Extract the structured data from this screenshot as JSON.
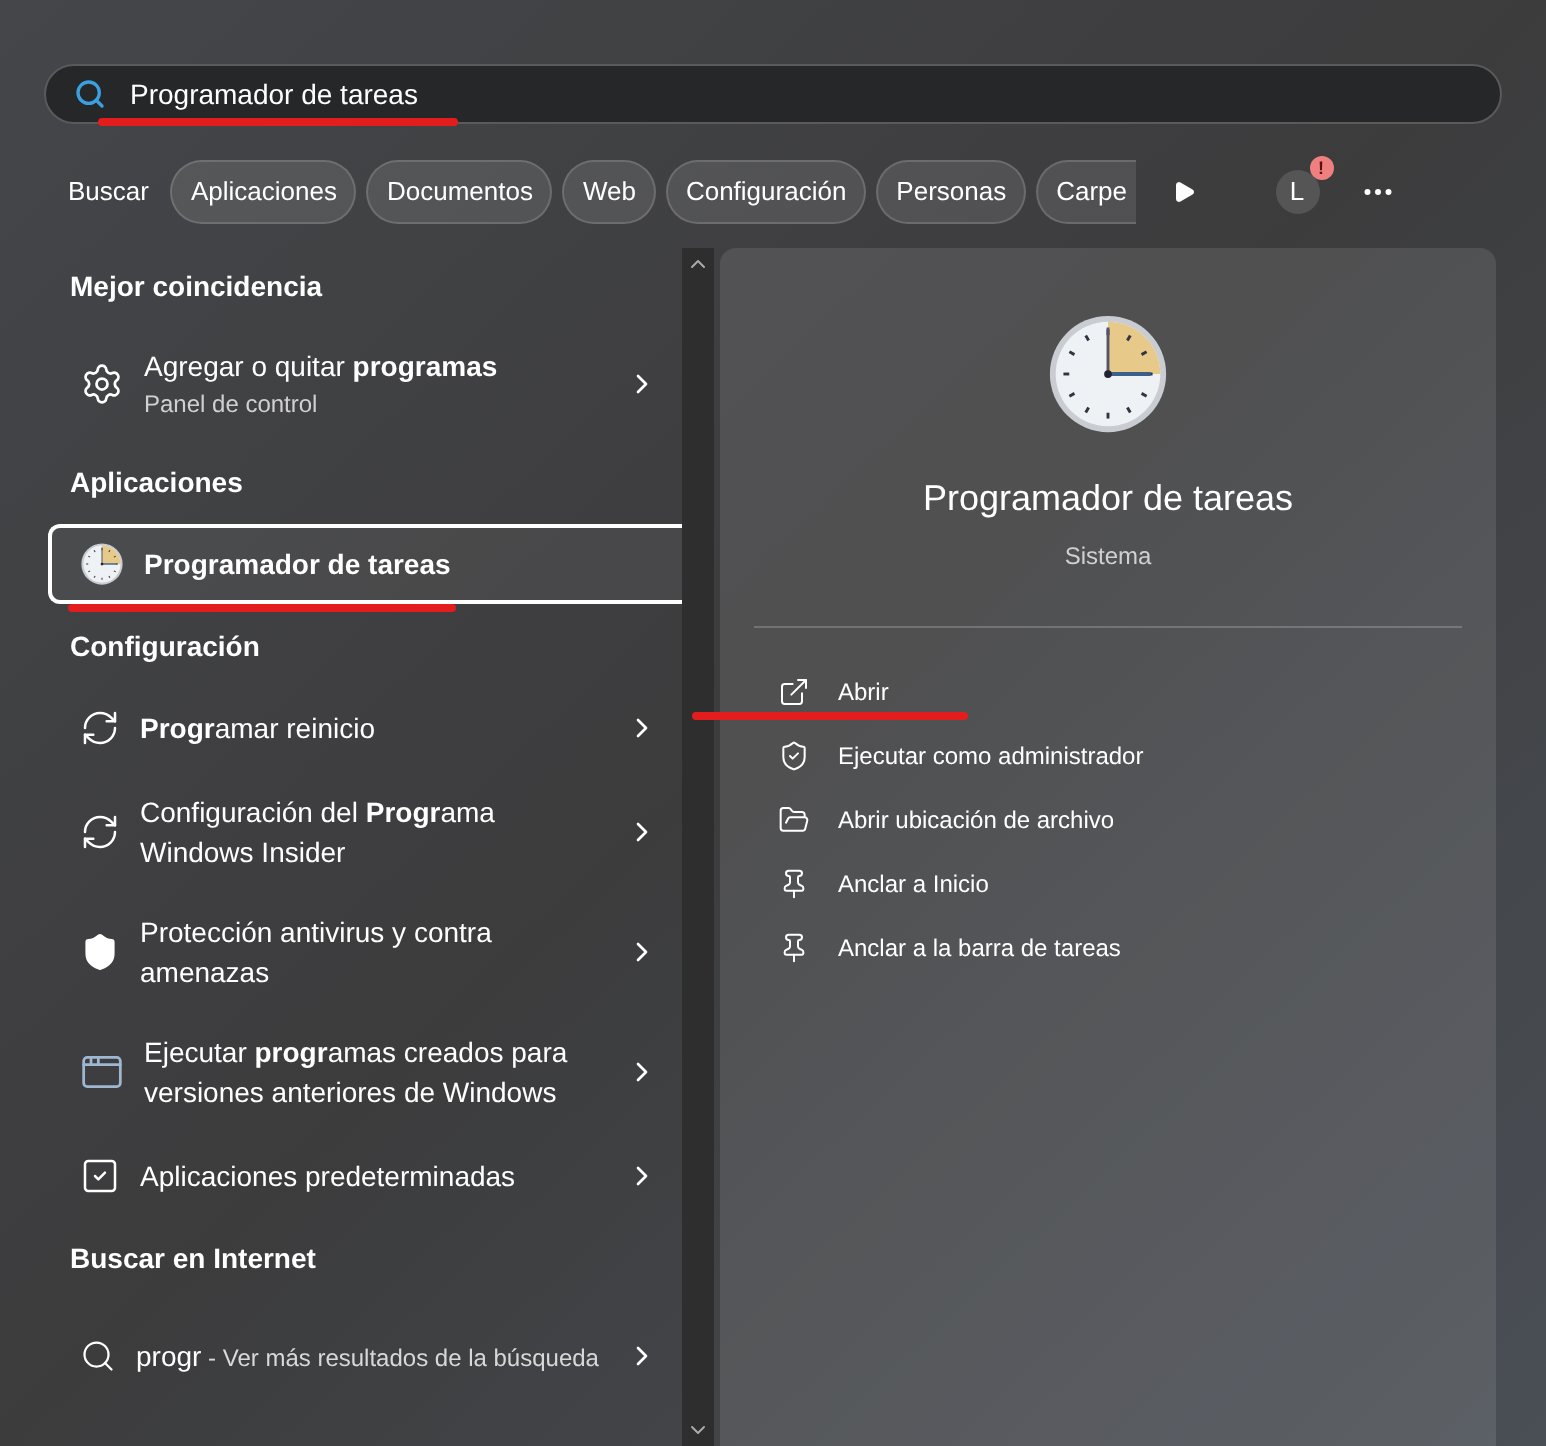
{
  "search": {
    "value": "Programador de tareas",
    "underlined": true
  },
  "filters": [
    {
      "label": "Buscar",
      "selected": true
    },
    {
      "label": "Aplicaciones",
      "selected": false
    },
    {
      "label": "Documentos",
      "selected": false
    },
    {
      "label": "Web",
      "selected": false
    },
    {
      "label": "Configuración",
      "selected": false
    },
    {
      "label": "Personas",
      "selected": false
    },
    {
      "label": "Carpe",
      "selected": false
    }
  ],
  "account": {
    "initial": "L",
    "badge": "!"
  },
  "sections": [
    {
      "title": "Mejor coincidencia",
      "items": [
        {
          "kind": "gear",
          "title": "Agregar o quitar **programas**",
          "subtitle": "Panel de control",
          "selected": false,
          "underlined": false,
          "chevron": true
        }
      ]
    },
    {
      "title": "Aplicaciones",
      "items": [
        {
          "kind": "clock",
          "title": "**Progr**amador de tareas",
          "selected": true,
          "underlined": true,
          "chevron": false
        }
      ]
    },
    {
      "title": "Configuración",
      "items": [
        {
          "kind": "refresh",
          "title": "**Progr**amar reinicio",
          "selected": false,
          "underlined": false,
          "chevron": true
        },
        {
          "kind": "refresh",
          "title": "Configuración del **Progr**ama Windows Insider",
          "selected": false,
          "underlined": false,
          "chevron": true
        },
        {
          "kind": "shield",
          "title": "Protección antivirus y contra amenazas",
          "selected": false,
          "underlined": false,
          "chevron": true
        },
        {
          "kind": "window",
          "title": "Ejecutar **progr**amas creados para versiones anteriores de Windows",
          "selected": false,
          "underlined": false,
          "chevron": true
        },
        {
          "kind": "defaults",
          "title": "Aplicaciones predeterminadas",
          "selected": false,
          "underlined": false,
          "chevron": true
        }
      ]
    },
    {
      "title": "Buscar en Internet",
      "items": [
        {
          "kind": "search",
          "title": "progr",
          "description": " - Ver más resultados de la búsqueda",
          "selected": false,
          "underlined": false,
          "chevron": true
        }
      ]
    }
  ],
  "detail": {
    "title": "Programador de tareas",
    "subtitle": "Sistema",
    "actions": [
      {
        "kind": "open",
        "label": "Abrir",
        "underlined": true
      },
      {
        "kind": "admin",
        "label": "Ejecutar como administrador",
        "underlined": false
      },
      {
        "kind": "folder",
        "label": "Abrir ubicación de archivo",
        "underlined": false
      },
      {
        "kind": "pin",
        "label": "Anclar a Inicio",
        "underlined": false
      },
      {
        "kind": "pin",
        "label": "Anclar a la barra de tareas",
        "underlined": false
      }
    ]
  }
}
